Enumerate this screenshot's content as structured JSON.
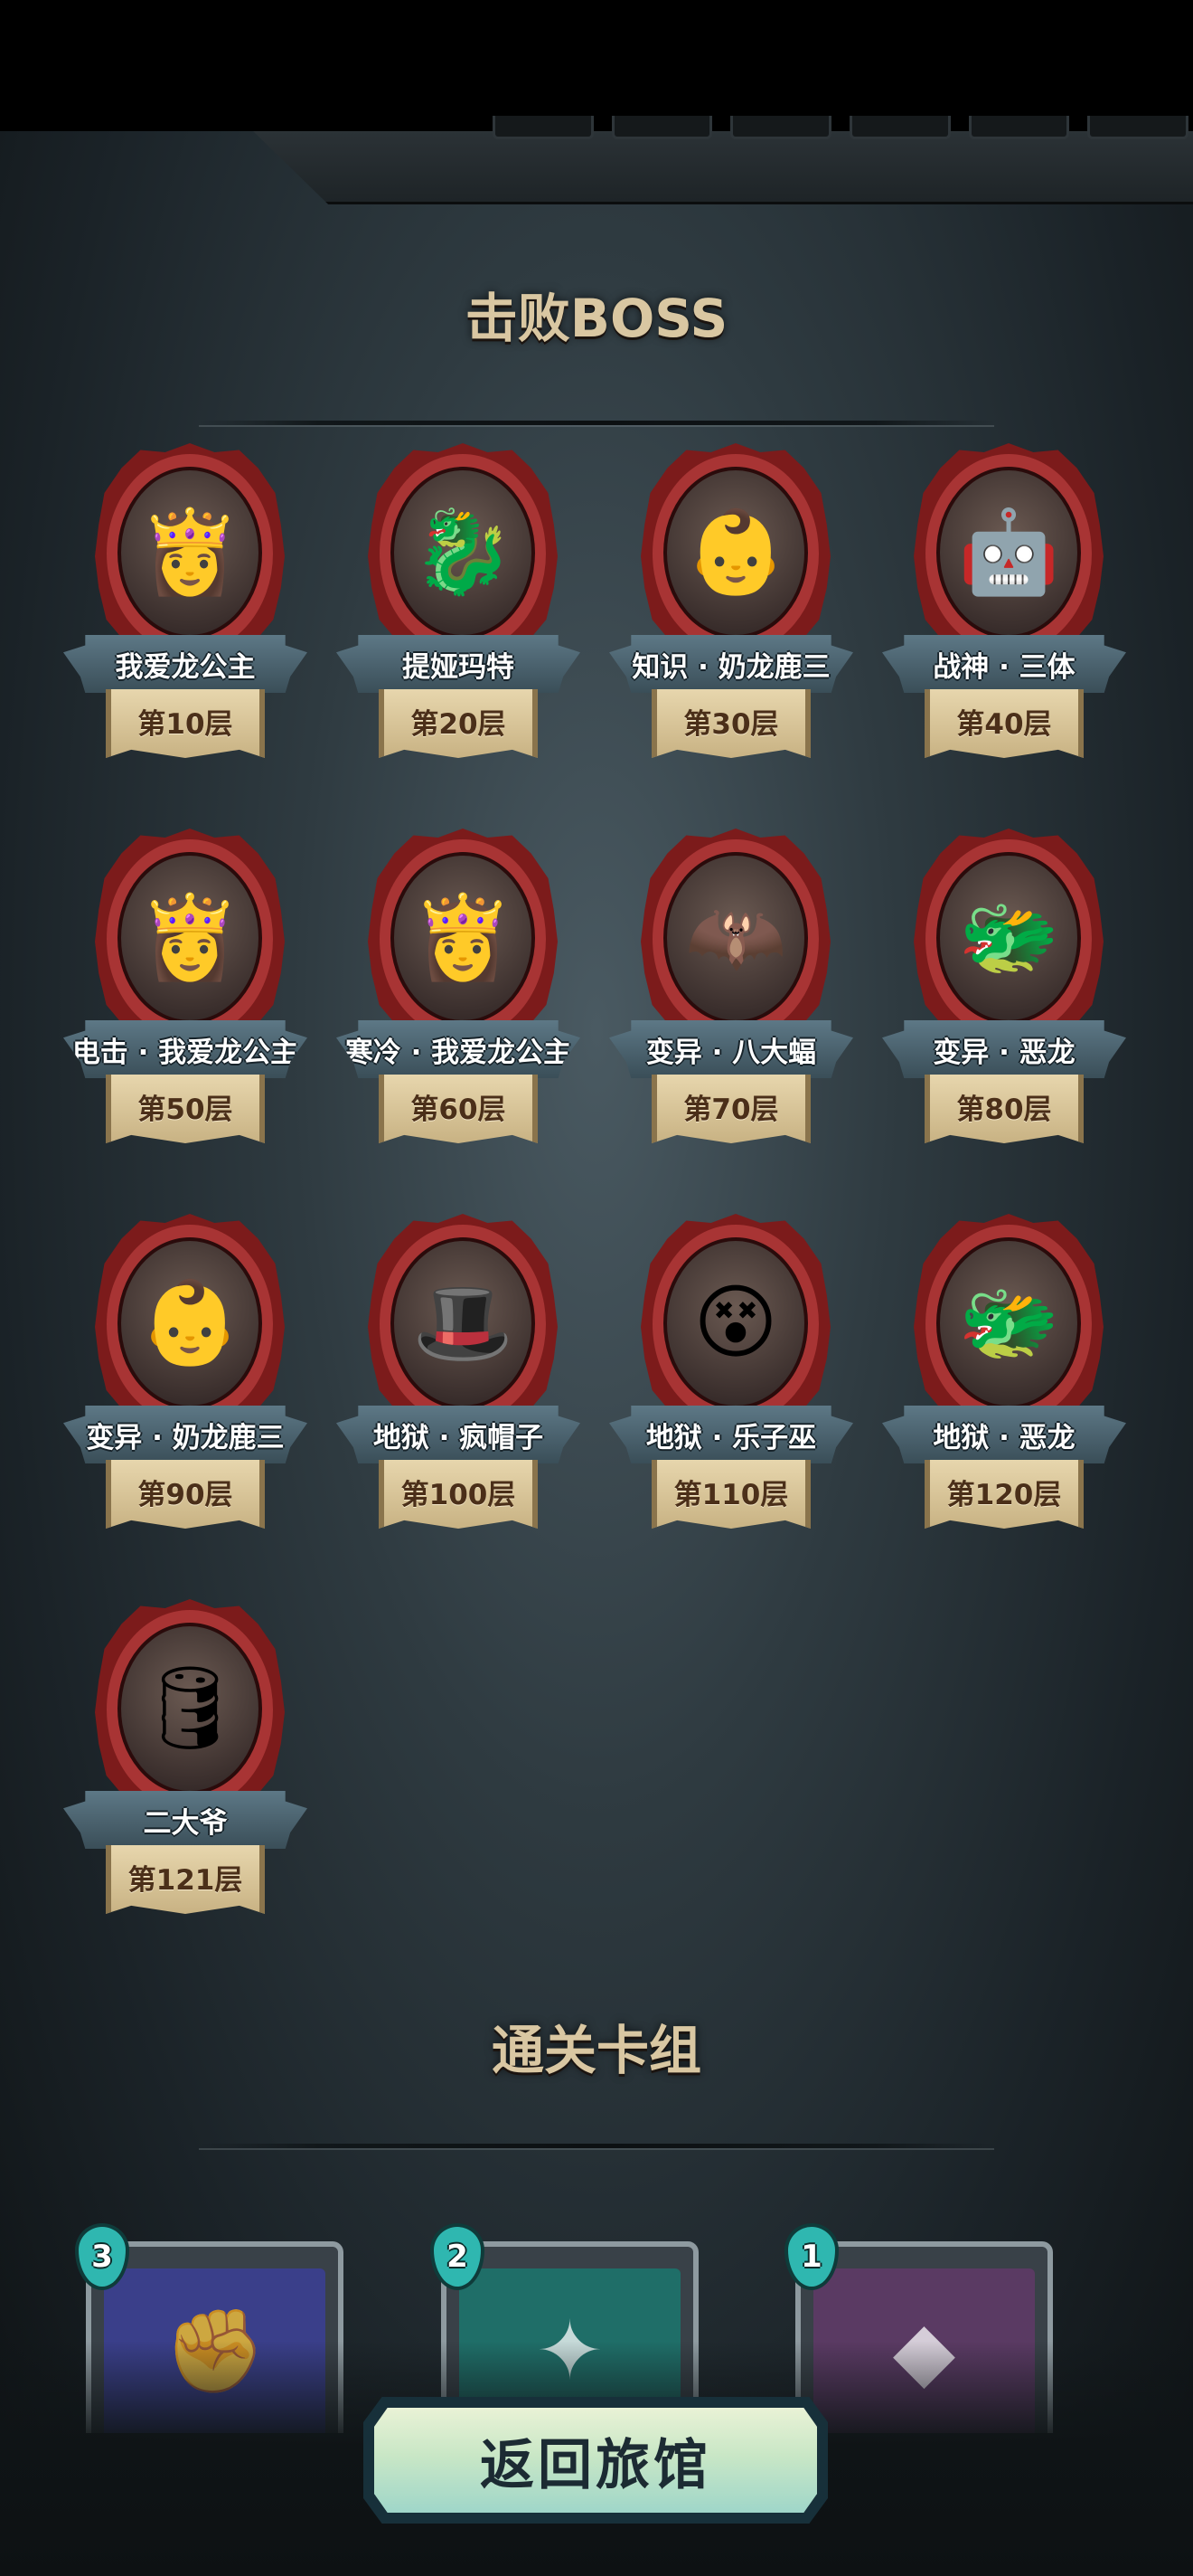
{
  "sections": {
    "bosses_title": "击败BOSS",
    "deck_title": "通关卡组"
  },
  "bosses": [
    {
      "name": "我爱龙公主",
      "floor": "第10层",
      "icon": "princess-portrait",
      "glyph": "👸"
    },
    {
      "name": "提娅玛特",
      "floor": "第20层",
      "icon": "purple-dragon-portrait",
      "glyph": "🐉"
    },
    {
      "name": "知识 · 奶龙鹿三",
      "floor": "第30层",
      "icon": "helmet-baby-portrait",
      "glyph": "👶"
    },
    {
      "name": "战神 · 三体",
      "floor": "第40层",
      "icon": "golden-robot-portrait",
      "glyph": "🤖"
    },
    {
      "name": "电击 · 我爱龙公主",
      "floor": "第50层",
      "icon": "princess-portrait",
      "glyph": "👸"
    },
    {
      "name": "寒冷 · 我爱龙公主",
      "floor": "第60层",
      "icon": "princess-portrait",
      "glyph": "👸"
    },
    {
      "name": "变异 · 八大蝠",
      "floor": "第70层",
      "icon": "bat-creature-portrait",
      "glyph": "🦇"
    },
    {
      "name": "变异 · 恶龙",
      "floor": "第80层",
      "icon": "red-dragon-portrait",
      "glyph": "🐲"
    },
    {
      "name": "变异 · 奶龙鹿三",
      "floor": "第90层",
      "icon": "helmet-baby-portrait",
      "glyph": "👶"
    },
    {
      "name": "地狱 · 疯帽子",
      "floor": "第100层",
      "icon": "mad-hatter-portrait",
      "glyph": "🎩"
    },
    {
      "name": "地狱 · 乐子巫",
      "floor": "第110层",
      "icon": "jester-witch-portrait",
      "glyph": "😵"
    },
    {
      "name": "地狱 · 恶龙",
      "floor": "第120层",
      "icon": "red-dragon-portrait",
      "glyph": "🐲"
    },
    {
      "name": "二大爷",
      "floor": "第121层",
      "icon": "armored-barrel-portrait",
      "glyph": "🛢"
    }
  ],
  "cards": [
    {
      "cost": "3",
      "icon": "golden-fist-card-art",
      "glyph": "✊",
      "color": "#3a3f8a"
    },
    {
      "cost": "2",
      "icon": "teal-armor-card-art",
      "glyph": "✦",
      "color": "#1f6e68"
    },
    {
      "cost": "1",
      "icon": "purple-crystal-card-art",
      "glyph": "◆",
      "color": "#5a3a63"
    }
  ],
  "buttons": {
    "return_label": "返回旅馆"
  },
  "colors": {
    "medal_red": "#a83434",
    "ribbon_blue": "#4a6470",
    "scroll_tan": "#dcc79a",
    "cost_teal": "#2fb7b0",
    "button_mint": "#c9e7c6"
  }
}
